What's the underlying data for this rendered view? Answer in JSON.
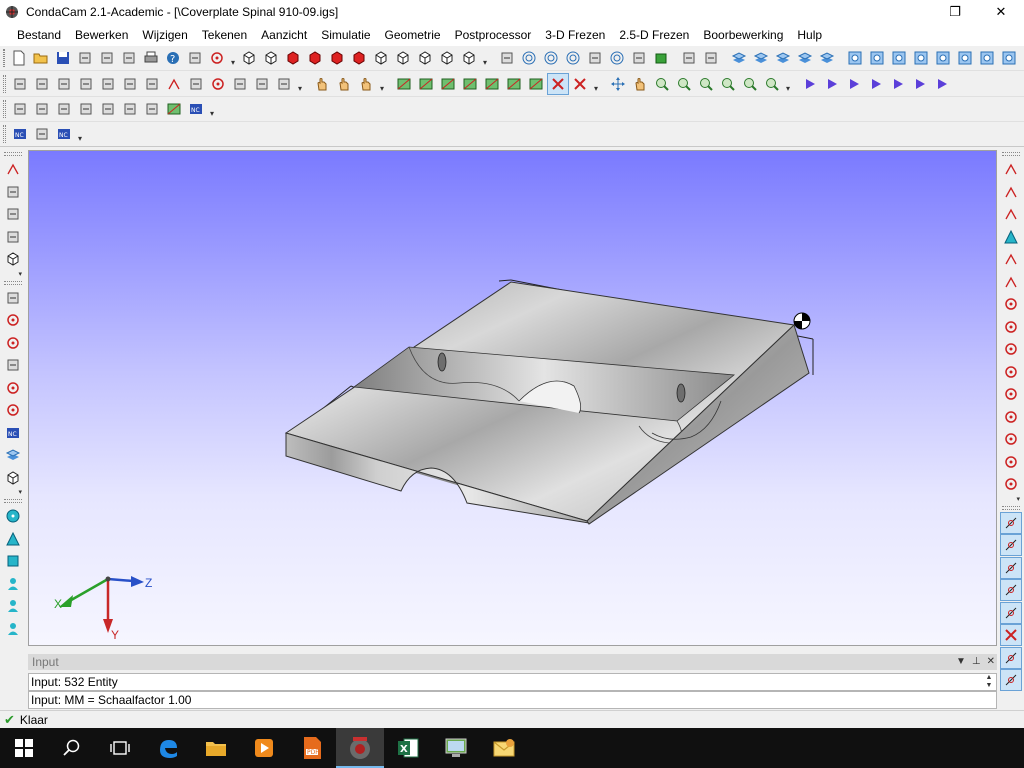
{
  "window": {
    "title": "CondaCam 2.1-Academic - [\\Coverplate Spinal 910-09.igs]",
    "restore_glyph": "❐",
    "close_glyph": "✕"
  },
  "menu": [
    {
      "id": "bestand",
      "label": "Bestand"
    },
    {
      "id": "bewerken",
      "label": "Bewerken"
    },
    {
      "id": "wijzigen",
      "label": "Wijzigen"
    },
    {
      "id": "tekenen",
      "label": "Tekenen"
    },
    {
      "id": "aanzicht",
      "label": "Aanzicht"
    },
    {
      "id": "simulatie",
      "label": "Simulatie"
    },
    {
      "id": "geometrie",
      "label": "Geometrie"
    },
    {
      "id": "postprocessor",
      "label": "Postprocessor"
    },
    {
      "id": "3d-frezen",
      "label": "3-D Frezen"
    },
    {
      "id": "25d-frezen",
      "label": "2.5-D Frezen"
    },
    {
      "id": "boorbewerking",
      "label": "Boorbewerking"
    },
    {
      "id": "hulp",
      "label": "Hulp"
    }
  ],
  "toolbars": {
    "row1_icons": [
      "new-file",
      "open-folder",
      "save",
      "cut",
      "copy",
      "paste",
      "print",
      "help",
      "undo",
      "redo",
      "more",
      "cube-wire",
      "cube-solid",
      "cube-red",
      "cube-red",
      "cube-red",
      "cube-red",
      "cube-iso",
      "cube-iso",
      "cube-iso",
      "cube-iso",
      "cube-iso",
      "more",
      "sep",
      "2d-curve",
      "spiral",
      "spiral",
      "spiral",
      "2d-curve",
      "spiral",
      "2d-curve",
      "grid-green",
      "sep",
      "tool-path",
      "tool-path",
      "sep",
      "layers",
      "layers",
      "layers",
      "layers",
      "layers",
      "sep",
      "circle-target",
      "circle-target",
      "circle-target",
      "square-target",
      "square-target",
      "square-target",
      "square-target",
      "square-target",
      "spiral-target",
      "wave"
    ],
    "row2_icons": [
      "arrow-select",
      "scale",
      "rotate-ccw",
      "rotate-cw",
      "move-h",
      "move-v",
      "move-diag",
      "arc",
      "lasso",
      "scissors",
      "delete-x",
      "delete-box",
      "eraser",
      "more",
      "sep",
      "hand",
      "grab",
      "pointer",
      "more",
      "sep",
      "frame",
      "frame",
      "frame",
      "frame",
      "frame",
      "frame",
      "frame",
      "cross-pressed",
      "cross",
      "more",
      "sep",
      "pan-move",
      "hand-pan",
      "zoom-in",
      "zoom-window",
      "zoom-fit",
      "zoom-all",
      "zoom-plus",
      "zoom-minus",
      "more",
      "sep",
      "play",
      "play2",
      "play3",
      "play4",
      "play5",
      "rewind",
      "rewind2"
    ],
    "row3_icons": [
      "undo-small",
      "cut-small",
      "copy-small",
      "paste-small",
      "find-small",
      "binoculars",
      "translate",
      "frame-small",
      "nc-blue",
      "more"
    ],
    "row4_icons": [
      "nc-program",
      "list",
      "nc-blue",
      "more"
    ]
  },
  "left_toolbar_icons": [
    "select-point",
    "dimension",
    "measure",
    "rotate-view",
    "view-cube",
    "sep",
    "cut-mill",
    "drill-red",
    "pocket-red",
    "contour",
    "scissors-red",
    "jet-red",
    "nc-red",
    "layers-green",
    "cube-green",
    "sep",
    "circle-tool",
    "triangle-tool",
    "square-tool",
    "person-tool",
    "plane-tool",
    "helix-tool"
  ],
  "right_toolbar_icons": [
    "point-dots",
    "line-seg",
    "polyline",
    "triangle-pt",
    "zigzag",
    "spline",
    "rect-red",
    "circle-red",
    "circle-red",
    "circle-red",
    "circle-red",
    "circle-red",
    "arc-red",
    "arc-red",
    "arc-red",
    "sep",
    "snap-end",
    "snap-on",
    "snap-mid",
    "snap-line",
    "snap-perp",
    "snap-cross",
    "snap-tangent",
    "snap-center"
  ],
  "viewport": {
    "axes": {
      "x_label": "X",
      "y_label": "Y",
      "z_label": "Z"
    }
  },
  "input_panel": {
    "header": "Input",
    "line1": "Input: 532 Entity",
    "line2": "Input: MM = Schaalfactor 1.00",
    "ctrl_dropdown": "▼",
    "ctrl_pin": "⊥",
    "ctrl_close": "✕"
  },
  "status": {
    "text": "Klaar",
    "icon": "check-icon"
  },
  "taskbar": [
    {
      "id": "start",
      "icon": "windows-logo"
    },
    {
      "id": "search",
      "icon": "search-icon"
    },
    {
      "id": "taskview",
      "icon": "task-view-icon"
    },
    {
      "id": "edge",
      "icon": "edge-icon"
    },
    {
      "id": "explorer",
      "icon": "folder-icon"
    },
    {
      "id": "media",
      "icon": "media-player-icon"
    },
    {
      "id": "pdf",
      "icon": "pdf-icon"
    },
    {
      "id": "condacam",
      "icon": "condacam-icon",
      "active": true
    },
    {
      "id": "excel",
      "icon": "excel-icon"
    },
    {
      "id": "remote",
      "icon": "remote-desktop-icon"
    },
    {
      "id": "mail",
      "icon": "mail-icon"
    }
  ],
  "colors": {
    "viewport_top": "#7a7aff",
    "viewport_bottom": "#f6f6ff",
    "axis_x": "#2aa02a",
    "axis_y": "#c82828",
    "axis_z": "#2850c8",
    "accent": "#6aa2d6"
  }
}
